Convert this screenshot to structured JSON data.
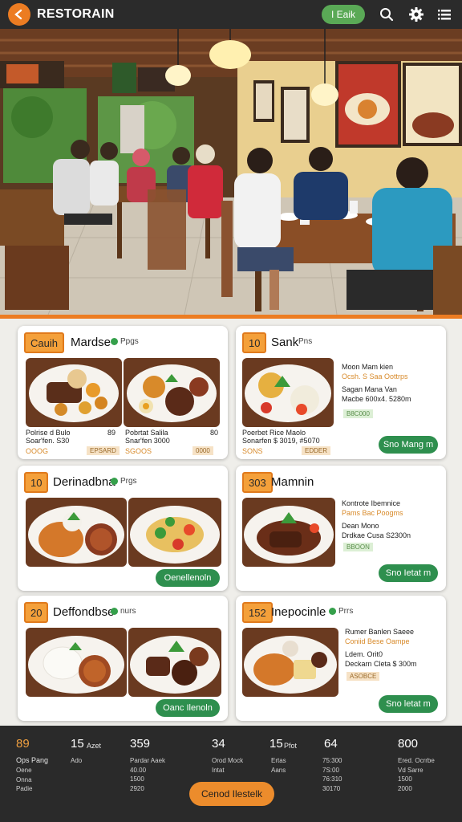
{
  "header": {
    "brand": "RESTORAIN",
    "edit_label": "I Eaik",
    "icons": [
      "back-arrow-icon",
      "search-icon",
      "gear-icon",
      "list-icon"
    ]
  },
  "colors": {
    "accent": "#ec7c22",
    "green": "#2e8f4e",
    "dark": "#2a2a2a"
  },
  "cards": [
    {
      "badge": "Cauih",
      "title": "Mardse",
      "sub": "Ppgs",
      "items": [
        {
          "name": "Polrise d Bulo",
          "qty": "89",
          "desc": "Soar'fen. S30",
          "code": "OOOG",
          "tag": "EPSARD"
        },
        {
          "name": "Pobrtat Salila",
          "qty": "80",
          "desc": "Snar'fen 3000",
          "code": "SGOOS",
          "tag": "0000"
        }
      ]
    },
    {
      "badge": "10",
      "title": "Sank",
      "sub": "Pns",
      "item_name": "Poerbet Rice Maolo",
      "item_desc": "Sonarfen $ 3019, #5070",
      "code": "SONS",
      "tag": "EDDER",
      "lines": [
        "Moon Mam kien",
        "Ocsh. S Saa Oottrps",
        "Sagan Mana Van",
        "Macbe 600x4. 5280m"
      ],
      "green_tag": "B8C000",
      "cta": "Sno Mang m"
    },
    {
      "badge": "10",
      "title": "Derinadbna",
      "sub": "Prgs",
      "cta": "Oenellenoln"
    },
    {
      "badge": "303",
      "title": "Mamnin",
      "lines": [
        "Kontrote Ibemnice",
        "Pams Bac Poogms",
        "Dean Mono",
        "Drdkae Cusa S2300n"
      ],
      "green_tag": "BBOON",
      "cta": "Sno Ietat m"
    },
    {
      "badge": "20",
      "title": "Deffondbse",
      "sub": "nurs",
      "cta": "Oanc Ilenoln"
    },
    {
      "badge": "152",
      "title": "Inepocinle",
      "sub": "Prrs",
      "lines": [
        "Rumer Banlen Saeee",
        "Coniid Bese Oampe",
        "Ldem. Orit0",
        "Deckarn Cleta $ 300m"
      ],
      "price_tag": "ASOBCE",
      "cta": "Sno letat m"
    }
  ],
  "footer": {
    "stats": [
      {
        "num": "89",
        "label": "Ops Pang",
        "lines": "Oene\nOnna\nPadie"
      },
      {
        "num": "15",
        "label": "Azet",
        "lines": "Ado"
      },
      {
        "num": "359",
        "label": "",
        "lines": "Pardar Aaek\n40.00\n1500\n2920"
      },
      {
        "num": "34",
        "label": "",
        "lines": "Orod Mock\nIntat"
      },
      {
        "num": "15",
        "label": "Pfot",
        "lines": "Ertas\nAans"
      },
      {
        "num": "64",
        "label": "",
        "lines": "75:300\n7S:00\n76:310\n30170"
      },
      {
        "num": "800",
        "label": "",
        "lines": "Ered. Ocrrbe\nVd Sarre\n1500\n2000"
      }
    ],
    "button": "Cenod Ilestelk"
  }
}
